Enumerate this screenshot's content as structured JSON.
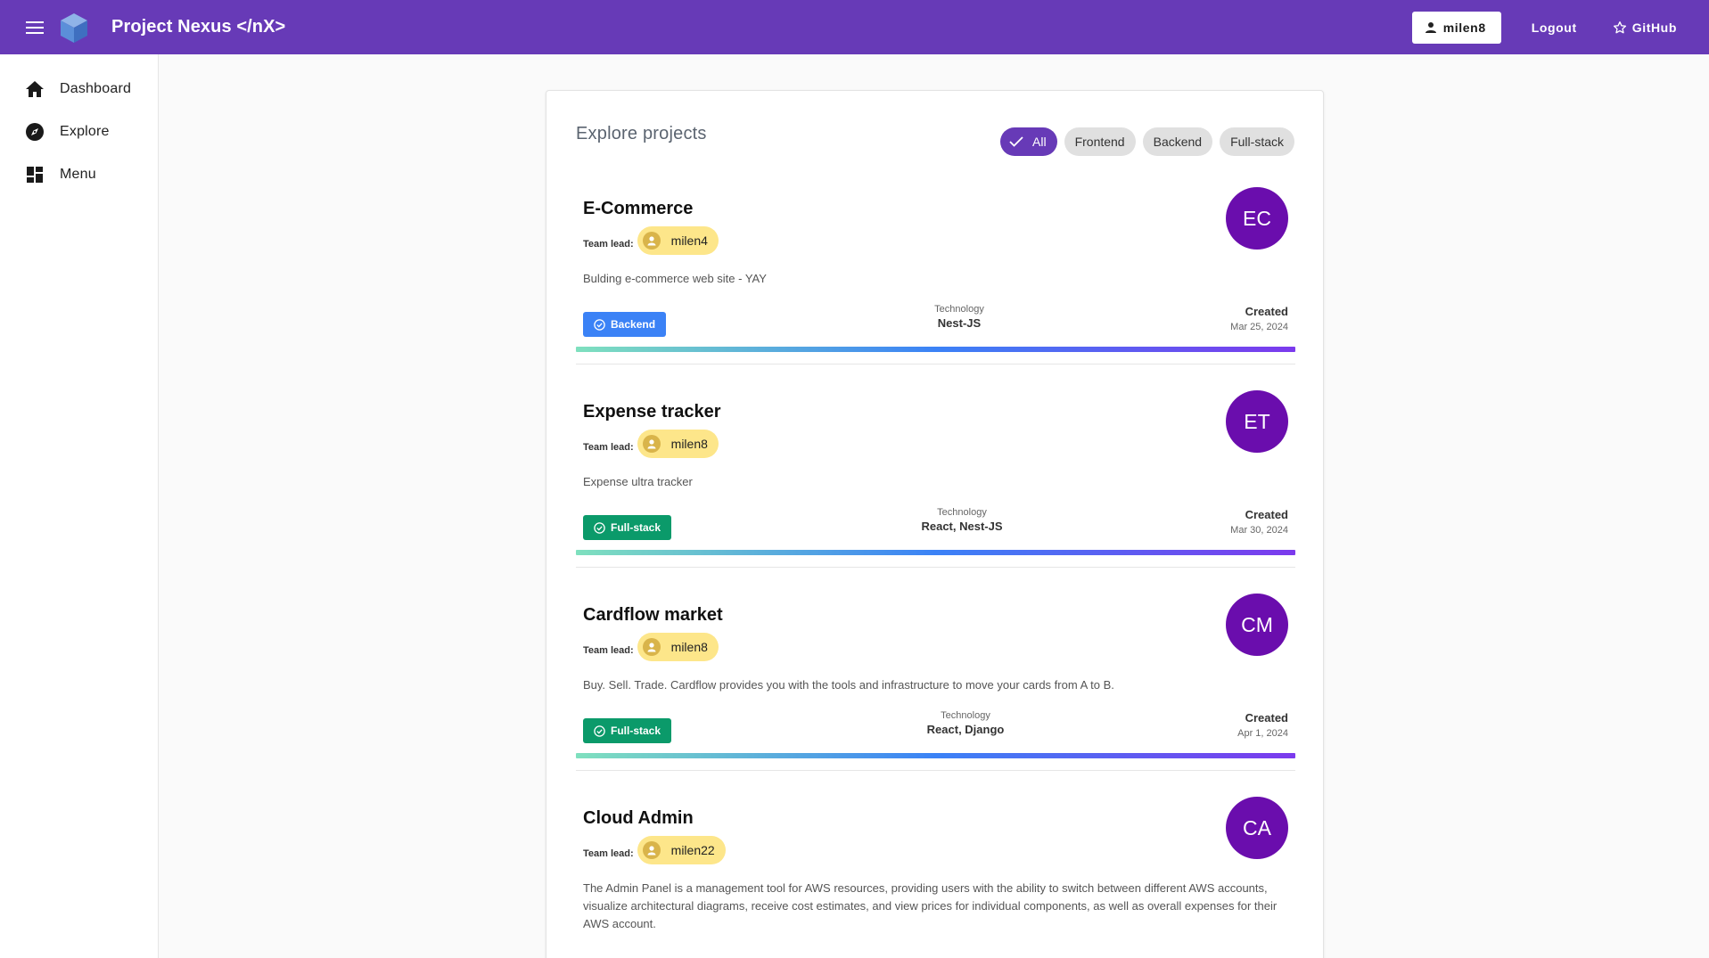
{
  "header": {
    "title": "Project Nexus </nX>",
    "user_label": "milen8",
    "logout_label": "Logout",
    "github_label": "GitHub"
  },
  "sidebar": {
    "items": [
      {
        "label": "Dashboard",
        "icon": "home-icon"
      },
      {
        "label": "Explore",
        "icon": "compass-icon"
      },
      {
        "label": "Menu",
        "icon": "dashboard-grid-icon"
      }
    ]
  },
  "main": {
    "title": "Explore projects",
    "filters": [
      "All",
      "Frontend",
      "Backend",
      "Full-stack"
    ],
    "active_filter": "All",
    "team_lead_label": "Team lead:",
    "technology_label": "Technology",
    "created_label": "Created",
    "projects": [
      {
        "title": "E-Commerce",
        "lead": "milen4",
        "initials": "EC",
        "description": "Bulding e-commerce web site - YAY",
        "tag": "Backend",
        "technology": "Nest-JS",
        "created": "Mar 25, 2024"
      },
      {
        "title": "Expense tracker",
        "lead": "milen8",
        "initials": "ET",
        "description": "Expense ultra tracker",
        "tag": "Full-stack",
        "technology": "React, Nest-JS",
        "created": "Mar 30, 2024"
      },
      {
        "title": "Cardflow market",
        "lead": "milen8",
        "initials": "CM",
        "description": "Buy. Sell. Trade. Cardflow provides you with the tools and infrastructure to move your cards from A to B.",
        "tag": "Full-stack",
        "technology": "React, Django",
        "created": "Apr 1, 2024"
      },
      {
        "title": "Cloud Admin",
        "lead": "milen22",
        "initials": "CA",
        "description": "The Admin Panel is a management tool for AWS resources, providing users with the ability to switch between different AWS accounts, visualize architectural diagrams, receive cost estimates, and view prices for individual components, as well as overall expenses for their AWS account."
      }
    ]
  },
  "colors": {
    "appbar": "#673ab7",
    "avatar": "#6a0dad",
    "backend_tag": "#3b82f6",
    "fullstack_tag": "#0b9a6a",
    "lead_chip": "#fde68a"
  }
}
